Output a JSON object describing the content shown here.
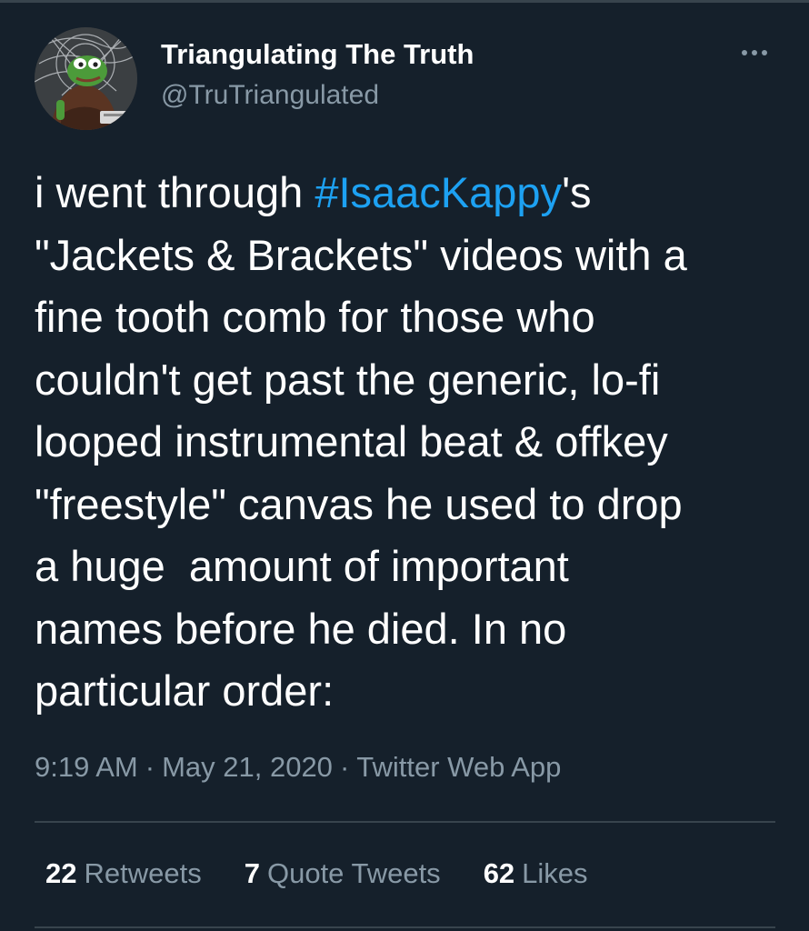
{
  "author": {
    "display_name": "Triangulating The Truth",
    "handle": "@TruTriangulated",
    "avatar_icon": "green-frog-cartoon-avatar"
  },
  "menu": {
    "more_icon": "ellipsis-icon"
  },
  "tweet": {
    "lines": [
      {
        "before": "i went through ",
        "hashtag": "#IsaacKappy",
        "after": "'s"
      },
      {
        "text": "\"Jackets & Brackets\" videos with a"
      },
      {
        "text": "fine tooth comb for those who"
      },
      {
        "text": "couldn't get past the generic, lo-fi"
      },
      {
        "text": "looped instrumental beat & offkey"
      },
      {
        "text": "\"freestyle\" canvas he used to drop"
      },
      {
        "text": "a huge  amount of important"
      },
      {
        "text": "names before he died. In no"
      },
      {
        "text": "particular order:"
      }
    ]
  },
  "meta": {
    "time": "9:19 AM",
    "separator": "·",
    "date": "May 21, 2020",
    "source": "Twitter Web App"
  },
  "stats": {
    "retweets": {
      "count": "22",
      "label": "Retweets"
    },
    "quote_tweets": {
      "count": "7",
      "label": "Quote Tweets"
    },
    "likes": {
      "count": "62",
      "label": "Likes"
    }
  },
  "colors": {
    "background": "#15202b",
    "link": "#1da1f2",
    "secondary_text": "#8899a6",
    "divider": "#38444d"
  }
}
